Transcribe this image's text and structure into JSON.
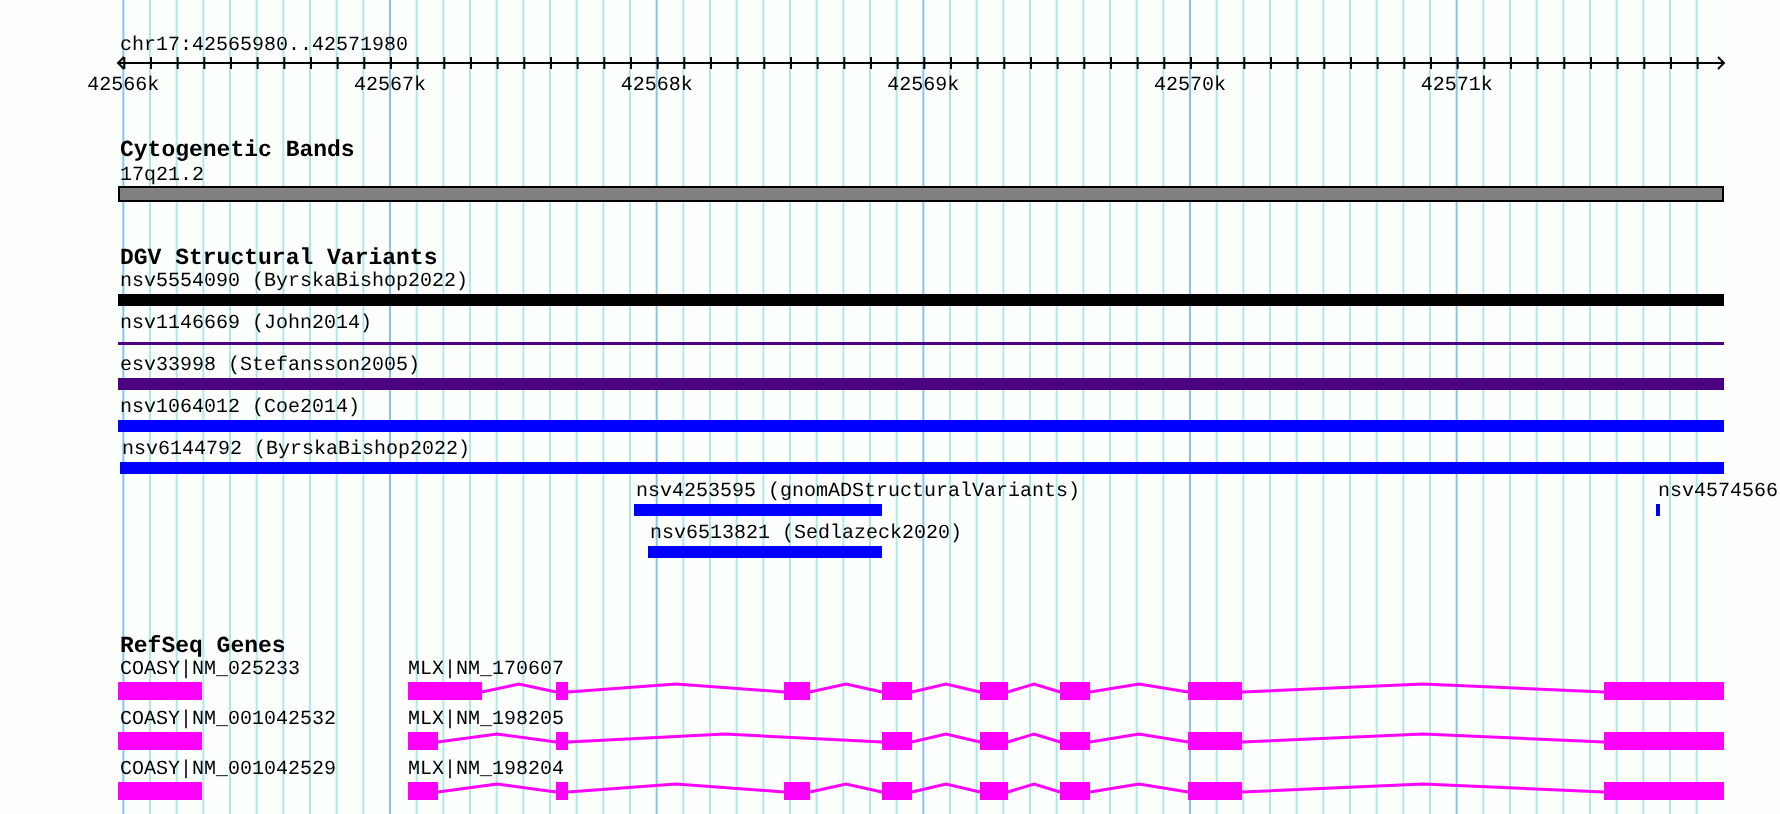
{
  "location": "chr17:42565980..42571980",
  "ruler": {
    "labels": [
      "42566k",
      "42567k",
      "42568k",
      "42569k",
      "42570k",
      "42571k"
    ]
  },
  "tracks": [
    {
      "kind": "band",
      "title": "Cytogenetic Bands",
      "features": [
        {
          "label": "17q21.2"
        }
      ]
    },
    {
      "kind": "variants",
      "title": "DGV Structural Variants",
      "features": [
        {
          "label": "nsv5554090 (ByrskaBishop2022)",
          "color": "#000000"
        },
        {
          "label": "nsv1146669 (John2014)",
          "color": "#4b0082"
        },
        {
          "label": "esv33998 (Stefansson2005)",
          "color": "#4b0082"
        },
        {
          "label": "nsv1064012 (Coe2014)",
          "color": "#0000ff"
        },
        {
          "label": "nsv6144792 (ByrskaBishop2022)",
          "color": "#0000ff"
        },
        {
          "label": "nsv4253595 (gnomADStructuralVariants)",
          "color": "#0000ff"
        },
        {
          "label": "nsv4574566",
          "color": "#0000ff"
        },
        {
          "label": "nsv6513821 (Sedlazeck2020)",
          "color": "#0000ff"
        }
      ]
    },
    {
      "kind": "genes",
      "title": "RefSeq Genes",
      "features": [
        {
          "label": "COASY|NM_025233"
        },
        {
          "label": "MLX|NM_170607"
        },
        {
          "label": "COASY|NM_001042532"
        },
        {
          "label": "MLX|NM_198205"
        },
        {
          "label": "COASY|NM_001042529"
        },
        {
          "label": "MLX|NM_198204"
        }
      ]
    }
  ]
}
